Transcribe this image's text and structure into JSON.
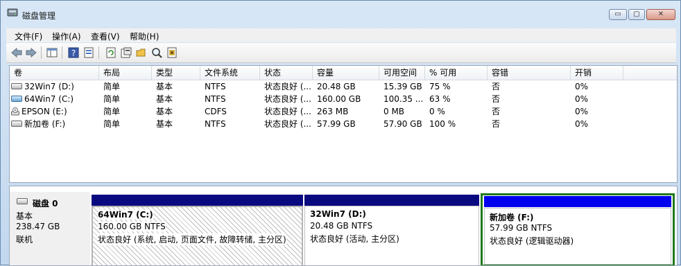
{
  "window": {
    "title": "磁盘管理",
    "controls": {
      "minimize": "▭",
      "maximize": "▢",
      "close": "✕"
    }
  },
  "menu": [
    {
      "label": "文件(F)"
    },
    {
      "label": "操作(A)"
    },
    {
      "label": "查看(V)"
    },
    {
      "label": "帮助(H)"
    }
  ],
  "toolbar": {
    "buttons": [
      "back-icon",
      "forward-icon",
      "console-tree-icon",
      "help-icon",
      "properties-icon",
      "refresh-icon",
      "properties-sheet-icon",
      "open-icon",
      "search-icon",
      "export-icon"
    ]
  },
  "volume_table": {
    "columns": [
      "卷",
      "布局",
      "类型",
      "文件系统",
      "状态",
      "容量",
      "可用空间",
      "% 可用",
      "容错",
      "开销"
    ],
    "rows": [
      {
        "volume": "32Win7  (D:)",
        "layout": "简单",
        "type": "基本",
        "fs": "NTFS",
        "status": "状态良好 (...",
        "capacity": "20.48 GB",
        "free": "15.39 GB",
        "pct": "75 %",
        "fault": "否",
        "overhead": "0%",
        "icon": "drive"
      },
      {
        "volume": "64Win7  (C:)",
        "layout": "简单",
        "type": "基本",
        "fs": "NTFS",
        "status": "状态良好 (...",
        "capacity": "160.00 GB",
        "free": "100.35 ...",
        "pct": "63 %",
        "fault": "否",
        "overhead": "0%",
        "icon": "system-drive"
      },
      {
        "volume": "EPSON (E:)",
        "layout": "简单",
        "type": "基本",
        "fs": "CDFS",
        "status": "状态良好 (...",
        "capacity": "263 MB",
        "free": "0 MB",
        "pct": "0 %",
        "fault": "否",
        "overhead": "0%",
        "icon": "cd-drive"
      },
      {
        "volume": "新加卷 (F:)",
        "layout": "简单",
        "type": "基本",
        "fs": "NTFS",
        "status": "状态良好 (...",
        "capacity": "57.99 GB",
        "free": "57.90 GB",
        "pct": "100 %",
        "fault": "否",
        "overhead": "0%",
        "icon": "drive"
      }
    ]
  },
  "disk": {
    "name": "磁盘 0",
    "type": "基本",
    "size": "238.47 GB",
    "state": "联机",
    "partitions": [
      {
        "name": "64Win7   (C:)",
        "size_fs": "160.00 GB NTFS",
        "status": "状态良好 (系统, 启动, 页面文件, 故障转储, 主分区)",
        "bar_color": "#0a0a80"
      },
      {
        "name": "32Win7   (D:)",
        "size_fs": "20.48 GB NTFS",
        "status": "状态良好 (活动, 主分区)",
        "bar_color": "#0a0a80"
      },
      {
        "name": "新加卷  (F:)",
        "size_fs": "57.99 GB NTFS",
        "status": "状态良好 (逻辑驱动器)",
        "bar_color": "#0000ee",
        "selected_border": "#1e7a1e"
      }
    ]
  }
}
